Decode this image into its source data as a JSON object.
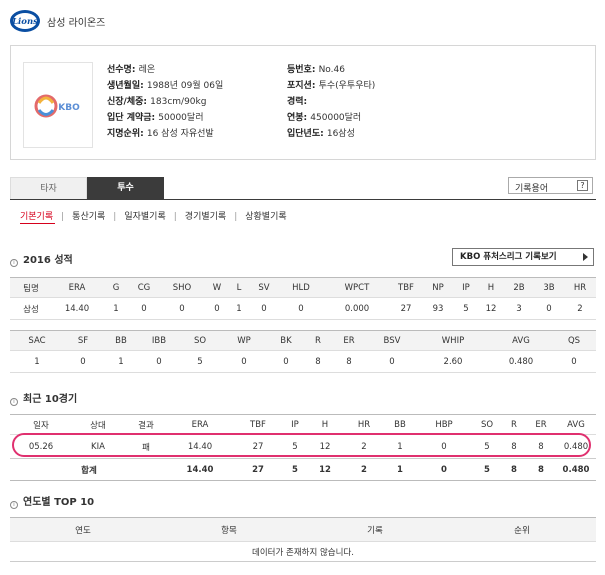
{
  "header": {
    "team_name": "삼성 라이온즈",
    "logo_text": "Lions"
  },
  "profile": {
    "photo_placeholder": "KBO",
    "left": [
      {
        "label": "선수명: ",
        "value": "레온"
      },
      {
        "label": "생년월일: ",
        "value": "1988년 09월 06일"
      },
      {
        "label": "신장/체중: ",
        "value": "183cm/90kg"
      },
      {
        "label": "입단 계약금: ",
        "value": "50000달러"
      },
      {
        "label": "지명순위: ",
        "value": "16 삼성 자유선발"
      }
    ],
    "right": [
      {
        "label": "등번호: ",
        "value": "No.46"
      },
      {
        "label": "포지션: ",
        "value": "투수(우투우타)"
      },
      {
        "label": "경력: ",
        "value": ""
      },
      {
        "label": "연봉: ",
        "value": "450000달러"
      },
      {
        "label": "입단년도: ",
        "value": "16삼성"
      }
    ]
  },
  "tabs": {
    "batter": "타자",
    "pitcher": "투수"
  },
  "glossary": {
    "label": "기록용어",
    "help": "?"
  },
  "subnav": [
    "기본기록",
    "통산기록",
    "일자별기록",
    "경기별기록",
    "상황별기록"
  ],
  "subnav_sep": "|",
  "season": {
    "title": "2016 성적",
    "kbo_button": "KBO 퓨처스리그 기록보기",
    "table1": {
      "headers": [
        "팀명",
        "ERA",
        "G",
        "CG",
        "SHO",
        "W",
        "L",
        "SV",
        "HLD",
        "WPCT",
        "TBF",
        "NP",
        "IP",
        "H",
        "2B",
        "3B",
        "HR"
      ],
      "row": [
        "삼성",
        "14.40",
        "1",
        "0",
        "0",
        "0",
        "1",
        "0",
        "0",
        "0.000",
        "27",
        "93",
        "5",
        "12",
        "3",
        "0",
        "2"
      ]
    },
    "table2": {
      "headers": [
        "SAC",
        "SF",
        "BB",
        "IBB",
        "SO",
        "WP",
        "BK",
        "R",
        "ER",
        "BSV",
        "WHIP",
        "AVG",
        "QS"
      ],
      "row": [
        "1",
        "0",
        "1",
        "0",
        "5",
        "0",
        "0",
        "8",
        "8",
        "0",
        "2.60",
        "0.480",
        "0"
      ]
    }
  },
  "recent": {
    "title": "최근 10경기",
    "headers": [
      "일자",
      "상대",
      "결과",
      "ERA",
      "TBF",
      "IP",
      "H",
      "HR",
      "BB",
      "HBP",
      "SO",
      "R",
      "ER",
      "AVG"
    ],
    "row": [
      "05.26",
      "KIA",
      "패",
      "14.40",
      "27",
      "5",
      "12",
      "2",
      "1",
      "0",
      "5",
      "8",
      "8",
      "0.480"
    ],
    "total": [
      "합계",
      "14.40",
      "27",
      "5",
      "12",
      "2",
      "1",
      "0",
      "5",
      "8",
      "8",
      "0.480"
    ]
  },
  "yearly": {
    "title": "연도별 TOP 10",
    "headers": [
      "연도",
      "항목",
      "기록",
      "순위"
    ],
    "empty": "데이터가 존재하지 않습니다."
  },
  "colors": {
    "accent": "#d6001c",
    "highlight": "#e0306f",
    "tab_active": "#3b3b3b"
  }
}
